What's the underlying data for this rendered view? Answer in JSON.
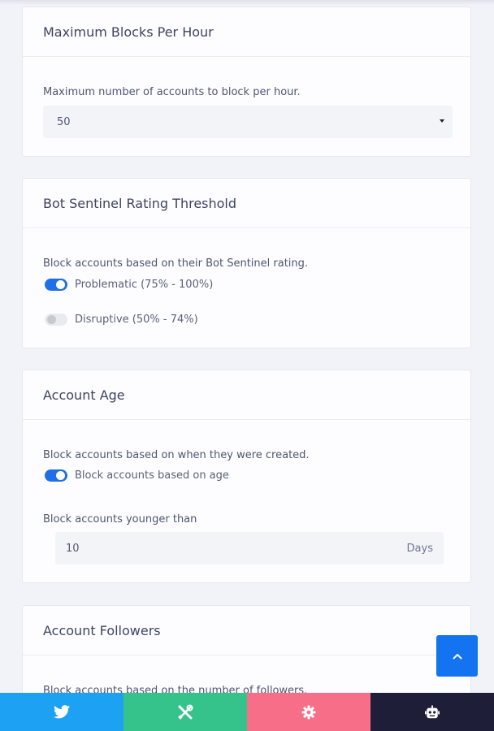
{
  "max_blocks": {
    "title": "Maximum Blocks Per Hour",
    "description": "Maximum number of accounts to block per hour.",
    "selected_value": "50"
  },
  "rating_threshold": {
    "title": "Bot Sentinel Rating Threshold",
    "description": "Block accounts based on their Bot Sentinel rating.",
    "toggles": [
      {
        "label": "Problematic (75% - 100%)",
        "on": true
      },
      {
        "label": "Disruptive (50% - 74%)",
        "on": false
      }
    ]
  },
  "account_age": {
    "title": "Account Age",
    "description": "Block accounts based on when they were created.",
    "toggle_label": "Block accounts based on age",
    "toggle_on": true,
    "field_label": "Block accounts younger than",
    "field_value": "10",
    "field_suffix": "Days"
  },
  "account_followers": {
    "title": "Account Followers",
    "description": "Block accounts based on the number of followers."
  },
  "colors": {
    "accent": "#1f6fe8",
    "scroll_top": "#1473f0",
    "nav_twitter": "#1da1f2",
    "nav_tools": "#36c28b",
    "nav_settings": "#f76e88",
    "nav_bot": "#1f1e38"
  },
  "icons": {
    "scroll_top": "chevron-up-icon",
    "nav": [
      "twitter-icon",
      "tools-icon",
      "gear-icon",
      "robot-icon"
    ]
  }
}
